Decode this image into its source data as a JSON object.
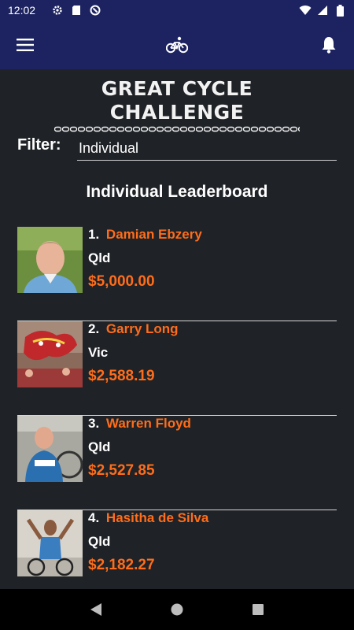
{
  "status_bar": {
    "time": "12:02",
    "icons": [
      "settings-icon",
      "sd-card-icon",
      "sync-icon",
      "wifi-icon",
      "signal-icon",
      "battery-icon"
    ]
  },
  "app_bar": {
    "menu_icon": "hamburger-menu-icon",
    "logo_icon": "bicycle-icon",
    "notification_icon": "bell-icon"
  },
  "logo": {
    "text": "GREAT CYCLE CHALLENGE"
  },
  "filter": {
    "label": "Filter:",
    "value": "Individual"
  },
  "leaderboard": {
    "title": "Individual Leaderboard",
    "entries": [
      {
        "rank": "1.",
        "name": "Damian Ebzery",
        "state": "Qld",
        "amount": "$5,000.00"
      },
      {
        "rank": "2.",
        "name": "Garry Long",
        "state": "Vic",
        "amount": "$2,588.19"
      },
      {
        "rank": "3.",
        "name": "Warren Floyd",
        "state": "Qld",
        "amount": "$2,527.85"
      },
      {
        "rank": "4.",
        "name": "Hasitha de Silva",
        "state": "Qld",
        "amount": "$2,182.27"
      }
    ]
  },
  "colors": {
    "status_bar": "#1c2360",
    "app_bar": "#1c2360",
    "background": "#1f2226",
    "accent": "#ff6d1a",
    "text": "#ffffff",
    "nav_bar": "#000000"
  },
  "nav_bar": {
    "icons": [
      "back-icon",
      "home-icon",
      "recents-icon"
    ]
  }
}
